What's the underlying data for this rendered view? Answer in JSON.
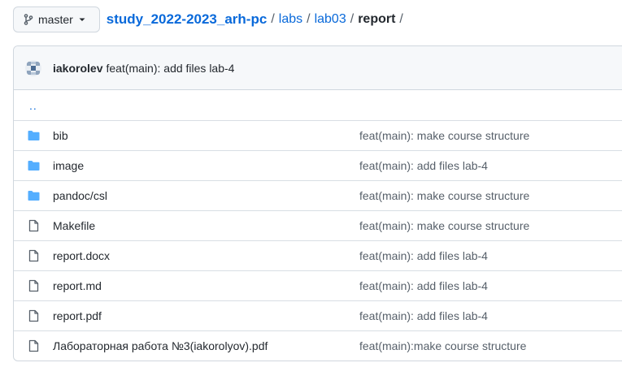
{
  "branch": {
    "label": "master",
    "icon": "git-branch-icon"
  },
  "breadcrumb": {
    "repo": "study_2022-2023_arh-pc",
    "parts": [
      "labs",
      "lab03"
    ],
    "current": "report",
    "separator": "/"
  },
  "latest_commit": {
    "author": "iakorolev",
    "message": "feat(main): add files lab-4"
  },
  "parent_link": "..",
  "files": [
    {
      "type": "folder",
      "name": "bib",
      "message": "feat(main): make course structure"
    },
    {
      "type": "folder",
      "name": "image",
      "message": "feat(main): add files lab-4"
    },
    {
      "type": "folder",
      "name": "pandoc/csl",
      "message": "feat(main): make course structure"
    },
    {
      "type": "file",
      "name": "Makefile",
      "message": "feat(main): make course structure"
    },
    {
      "type": "file",
      "name": "report.docx",
      "message": "feat(main): add files lab-4"
    },
    {
      "type": "file",
      "name": "report.md",
      "message": "feat(main): add files lab-4"
    },
    {
      "type": "file",
      "name": "report.pdf",
      "message": "feat(main): add files lab-4"
    },
    {
      "type": "file",
      "name": "Лабораторная работа №3(iakorolyov).pdf",
      "message": "feat(main):make course structure"
    }
  ],
  "colors": {
    "link": "#0969da",
    "folder": "#54aeff",
    "border": "#d0d7de",
    "muted": "#57606a"
  }
}
